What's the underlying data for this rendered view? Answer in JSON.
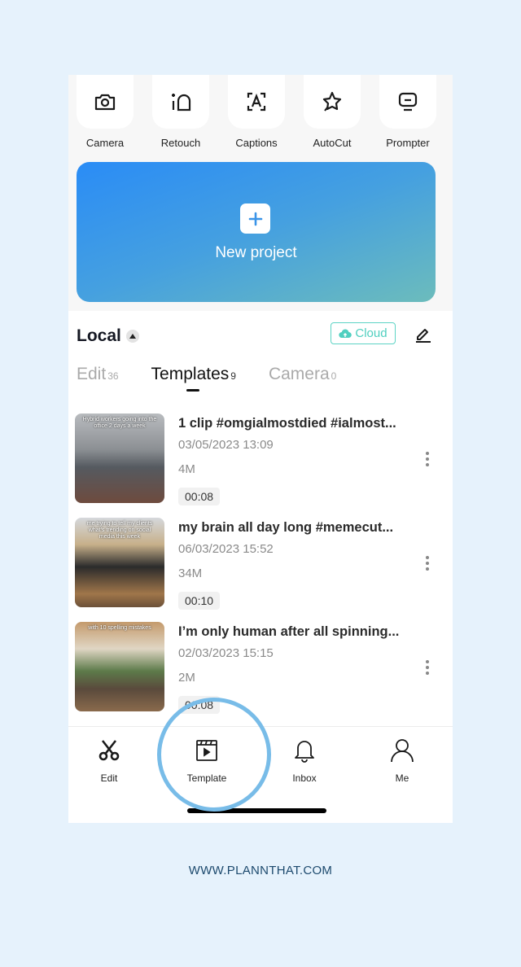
{
  "tools": [
    {
      "label": "Camera",
      "icon": "camera-icon"
    },
    {
      "label": "Retouch",
      "icon": "retouch-icon"
    },
    {
      "label": "Captions",
      "icon": "captions-icon"
    },
    {
      "label": "AutoCut",
      "icon": "autocut-icon"
    },
    {
      "label": "Prompter",
      "icon": "prompter-icon"
    }
  ],
  "new_project": {
    "label": "New project"
  },
  "section": {
    "title": "Local",
    "cloud_label": "Cloud"
  },
  "tabs": [
    {
      "label": "Edit",
      "count": "36"
    },
    {
      "label": "Templates",
      "count": "9"
    },
    {
      "label": "Camera",
      "count": "0"
    }
  ],
  "projects": [
    {
      "title": "1 clip #omgialmostdied #ialmost...",
      "date": "03/05/2023 13:09",
      "size": "4M",
      "duration": "00:08",
      "thumb_caption": "Hybrid workers going into the office 2 days a week"
    },
    {
      "title": "my brain all day long #memecut...",
      "date": "06/03/2023 15:52",
      "size": "34M",
      "duration": "00:10",
      "thumb_caption": "me trying to tell my clients what's trending on social media this week"
    },
    {
      "title": "I’m only human after all spinning...",
      "date": "02/03/2023 15:15",
      "size": "2M",
      "duration": "00:08",
      "thumb_caption": "with 10 spelling mistakes"
    }
  ],
  "nav": [
    {
      "label": "Edit",
      "icon": "scissors-icon"
    },
    {
      "label": "Template",
      "icon": "template-icon"
    },
    {
      "label": "Inbox",
      "icon": "bell-icon"
    },
    {
      "label": "Me",
      "icon": "person-icon"
    }
  ],
  "footer": {
    "text": "WWW.PLANNTHAT.COM"
  }
}
